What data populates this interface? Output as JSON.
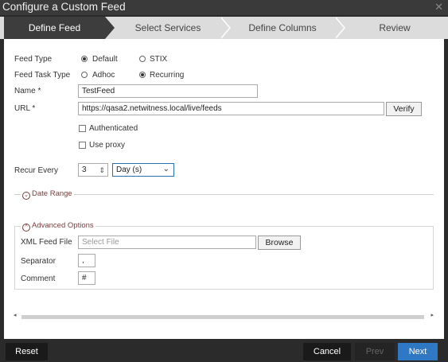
{
  "dialog": {
    "title": "Configure a Custom Feed"
  },
  "wizard": {
    "steps": [
      "Define Feed",
      "Select Services",
      "Define Columns",
      "Review"
    ]
  },
  "form": {
    "feed_type_label": "Feed Type",
    "feed_type_options": [
      "Default",
      "STIX"
    ],
    "feed_type_selected": "Default",
    "feed_task_type_label": "Feed Task Type",
    "feed_task_type_options": [
      "Adhoc",
      "Recurring"
    ],
    "feed_task_type_selected": "Recurring",
    "name_label": "Name *",
    "name_value": "TestFeed",
    "url_label": "URL *",
    "url_value": "https://qasa2.netwitness.local/live/feeds",
    "verify_label": "Verify",
    "authenticated_label": "Authenticated",
    "use_proxy_label": "Use proxy",
    "recur_every_label": "Recur Every",
    "recur_value": "3",
    "recur_unit": "Day (s)",
    "date_range_label": "Date Range",
    "advanced_label": "Advanced Options",
    "xml_feed_file_label": "XML Feed File",
    "xml_feed_file_placeholder": "Select File",
    "browse_label": "Browse",
    "separator_label": "Separator",
    "separator_value": ",",
    "comment_label": "Comment",
    "comment_value": "#"
  },
  "footer": {
    "reset": "Reset",
    "cancel": "Cancel",
    "prev": "Prev",
    "next": "Next"
  },
  "icons": {
    "close": "close-icon",
    "chevron_down": "chevron-down-icon",
    "chevron_up": "chevron-up-icon"
  },
  "colors": {
    "primary": "#2f78c4",
    "accent_text": "#7a3d3d",
    "title_bar": "#3a3a3a"
  }
}
